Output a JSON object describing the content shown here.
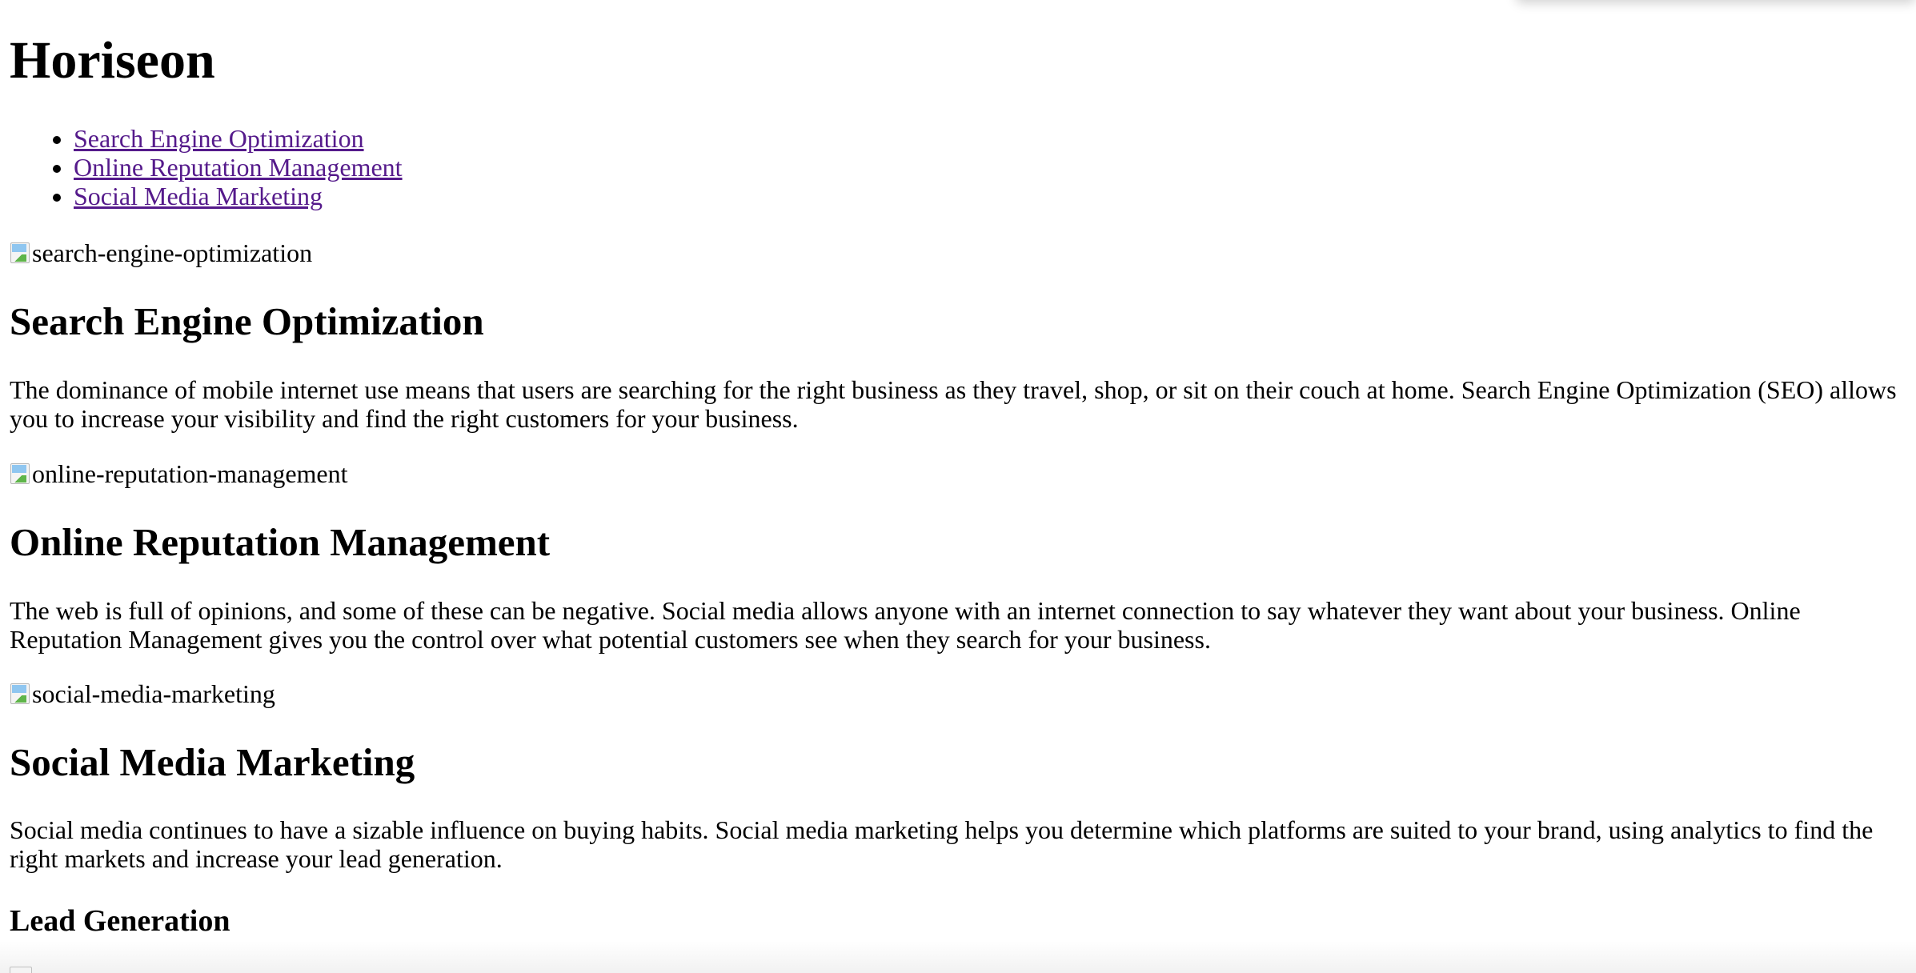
{
  "header": {
    "title": "Horiseon"
  },
  "nav": {
    "items": [
      {
        "label": "Search Engine Optimization"
      },
      {
        "label": "Online Reputation Management"
      },
      {
        "label": "Social Media Marketing"
      }
    ]
  },
  "sections": [
    {
      "image_alt": "search-engine-optimization",
      "title": "Search Engine Optimization",
      "text_line1": "The dominance of mobile internet use means that users are searching for the right business as they travel, shop, or sit on their couch at home. Search Engine Optimization (SEO) allows",
      "text_line2": "you to increase your visibility and find the right customers for your business."
    },
    {
      "image_alt": "online-reputation-management",
      "title": "Online Reputation Management",
      "text_line1": "The web is full of opinions, and some of these can be negative. Social media allows anyone with an internet connection to say whatever they want about your business. Online",
      "text_line2": "Reputation Management gives you the control over what potential customers see when they search for your business."
    },
    {
      "image_alt": "social-media-marketing",
      "title": "Social Media Marketing",
      "text_line1": "Social media continues to have a sizable influence on buying habits. Social media marketing helps you determine which platforms are suited to your brand, using analytics to find the",
      "text_line2": "right markets and increase your lead generation."
    }
  ],
  "aside": {
    "lead_title": "Lead Generation"
  },
  "colors": {
    "link_visited": "#551a8b",
    "text": "#000000",
    "background": "#ffffff"
  }
}
